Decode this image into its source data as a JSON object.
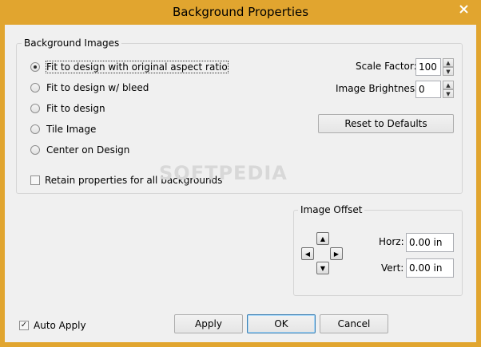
{
  "window": {
    "title": "Background Properties"
  },
  "background_images": {
    "legend": "Background Images",
    "options": [
      {
        "label": "Fit to design with original aspect ratio",
        "checked": true
      },
      {
        "label": "Fit to design w/ bleed",
        "checked": false
      },
      {
        "label": "Fit to design",
        "checked": false
      },
      {
        "label": "Tile Image",
        "checked": false
      },
      {
        "label": "Center on Design",
        "checked": false
      }
    ],
    "retain_label": "Retain properties for all backgrounds",
    "retain_checked": false,
    "scale_factor_label": "Scale Factor:",
    "scale_factor_value": "100",
    "brightness_label": "Image Brightness:",
    "brightness_value": "0",
    "reset_label": "Reset to Defaults"
  },
  "image_offset": {
    "legend": "Image Offset",
    "horz_label": "Horz:",
    "horz_value": "0.00 in",
    "vert_label": "Vert:",
    "vert_value": "0.00 in"
  },
  "footer": {
    "auto_apply_label": "Auto Apply",
    "auto_apply_checked": true,
    "apply_label": "Apply",
    "ok_label": "OK",
    "cancel_label": "Cancel"
  },
  "watermark": "SOFTPEDIA",
  "colors": {
    "titlebar": "#e1a52f",
    "client": "#f0f0f0",
    "close_icon": "#ffffff"
  }
}
